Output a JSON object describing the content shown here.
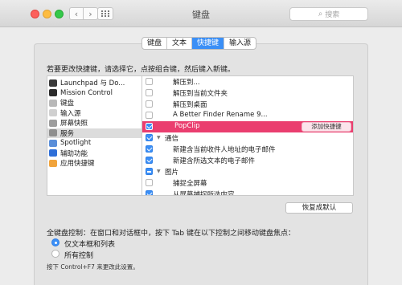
{
  "window": {
    "title": "键盘",
    "search_placeholder": "搜索",
    "search_icon": "magnifier-icon",
    "nav_back_icon": "chevron-left-icon",
    "nav_forward_icon": "chevron-right-icon",
    "show_all_icon": "grid-icon"
  },
  "tabs": [
    {
      "label": "键盘",
      "active": false
    },
    {
      "label": "文本",
      "active": false
    },
    {
      "label": "快捷键",
      "active": true
    },
    {
      "label": "输入源",
      "active": false
    }
  ],
  "instruction": "若要更改快捷键，请选择它，点按组合键，然后键入新键。",
  "categories": [
    {
      "label": "Launchpad 与 Do...",
      "icon": "launchpad-icon",
      "color": "#3a3a3a",
      "selected": false
    },
    {
      "label": "Mission Control",
      "icon": "mission-control-icon",
      "color": "#2b2b2b",
      "selected": false
    },
    {
      "label": "键盘",
      "icon": "keyboard-icon",
      "color": "#b8b8b8",
      "selected": false
    },
    {
      "label": "输入源",
      "icon": "input-source-icon",
      "color": "#d0d0d0",
      "selected": false
    },
    {
      "label": "屏幕快照",
      "icon": "screenshot-icon",
      "color": "#9d9d9d",
      "selected": false
    },
    {
      "label": "服务",
      "icon": "gear-icon",
      "color": "#8e8e8e",
      "selected": true
    },
    {
      "label": "Spotlight",
      "icon": "spotlight-icon",
      "color": "#5b8fd9",
      "selected": false
    },
    {
      "label": "辅助功能",
      "icon": "accessibility-icon",
      "color": "#2f6fd8",
      "selected": false
    },
    {
      "label": "应用快捷键",
      "icon": "app-shortcuts-icon",
      "color": "#f1a43c",
      "selected": false
    }
  ],
  "services": [
    {
      "label": "解压到...",
      "check": "none",
      "type": "item",
      "selected": false
    },
    {
      "label": "解压到当前文件夹",
      "check": "none",
      "type": "item",
      "selected": false
    },
    {
      "label": "解压到桌面",
      "check": "none",
      "type": "item",
      "selected": false
    },
    {
      "label": "A Better Finder Rename 9...",
      "check": "none",
      "type": "item",
      "selected": false
    },
    {
      "label": "PopClip",
      "check": "checked",
      "type": "item",
      "selected": true,
      "shortcut_button": "添加快捷键"
    },
    {
      "label": "通信",
      "check": "checked",
      "type": "group",
      "selected": false
    },
    {
      "label": "新建含当前收件人地址的电子邮件",
      "check": "checked",
      "type": "item",
      "selected": false
    },
    {
      "label": "新建含所选文本的电子邮件",
      "check": "checked",
      "type": "item",
      "selected": false
    },
    {
      "label": "图片",
      "check": "mixed",
      "type": "group",
      "selected": false
    },
    {
      "label": "捕捉全屏幕",
      "check": "none",
      "type": "item",
      "selected": false
    },
    {
      "label": "从屏幕捕捉所选内容",
      "check": "checked",
      "type": "item",
      "selected": false
    }
  ],
  "restore_defaults": "恢复成默认",
  "keyboard_control": {
    "label": "全键盘控制：在窗口和对话框中，按下 Tab 键在以下控制之间移动键盘焦点：",
    "options": [
      {
        "label": "仅文本框和列表",
        "selected": true
      },
      {
        "label": "所有控制",
        "selected": false
      }
    ],
    "hint": "按下 Control+F7 来更改此设置。"
  }
}
